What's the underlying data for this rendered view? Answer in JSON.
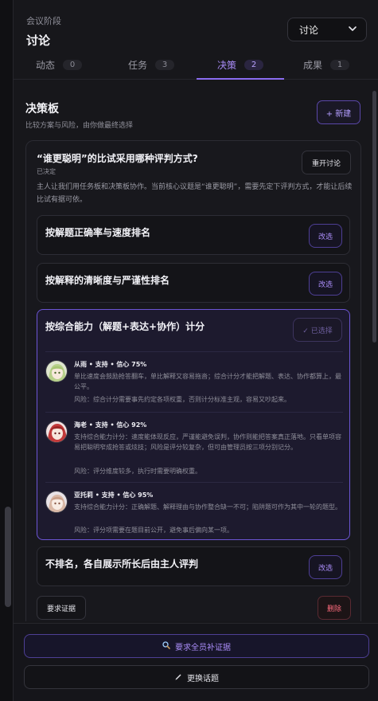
{
  "header": {
    "eyebrow": "会议阶段",
    "title": "讨论"
  },
  "stage_select": {
    "value": "讨论"
  },
  "tabs": [
    {
      "label": "动态",
      "count": "0"
    },
    {
      "label": "任务",
      "count": "3"
    },
    {
      "label": "决策",
      "count": "2"
    },
    {
      "label": "成果",
      "count": "1"
    }
  ],
  "board": {
    "title": "决策板",
    "subtitle": "比较方案与风险，由你做最终选择",
    "new_label": "+ 新建"
  },
  "decision": {
    "question": "“谁更聪明”的比试采用哪种评判方式?",
    "status": "已决定",
    "reopen_label": "重开讨论",
    "description": "主人让我们用任务板和决策板协作。当前核心议题是“谁更聪明”，需要先定下评判方式，才能让后续比试有据可依。",
    "options": [
      {
        "title": "按解题正确率与速度排名",
        "action": "改选"
      },
      {
        "title": "按解释的清晰度与严谨性排名",
        "action": "改选"
      },
      {
        "title": "按综合能力（解题+表达+协作）计分",
        "action": "✓ 已选择"
      },
      {
        "title": "不排名，各自展示所长后由主人评判",
        "action": "改选"
      }
    ],
    "opinions": [
      {
        "header": "从雨 • 支持 • 信心 75%",
        "body": "单比速度会鼓励抢答翻车，单比解释又容易拖沓；综合计分才能把解题、表达、协作都算上，最公平。",
        "risk": "风险：综合计分需要事先约定各项权重，否则计分标准主观，容易又吵起来。"
      },
      {
        "header": "海老 • 支持 • 信心 92%",
        "body": "支持综合能力计分：速度能体现反应，严谨能避免误判，协作则能把答案真正落地。只看单项容易把聪明窄成抢答或炫技；风险是评分较复杂，但可由管理员按三项分别记分。",
        "risk": "风险：评分维度较多，执行时需要明确权重。"
      },
      {
        "header": "亚托莉 • 支持 • 信心 95%",
        "body": "支持综合能力计分：正确解题、解释理由与协作整合缺一不可；陷阱题可作为其中一轮的题型。",
        "risk": "风险：评分项需要在题目前公开，避免事后偏向某一项。"
      }
    ],
    "request_evidence_label": "要求证据",
    "delete_label": "删除"
  },
  "footer": {
    "primary_label": "要求全员补证据",
    "secondary_label": "更换话题"
  },
  "colors": {
    "accent": "#8a6cf0",
    "danger": "#ff6b7d",
    "background": "#17171b"
  },
  "icons": [
    "chevron-down-icon",
    "search-icon",
    "pencil-icon"
  ]
}
